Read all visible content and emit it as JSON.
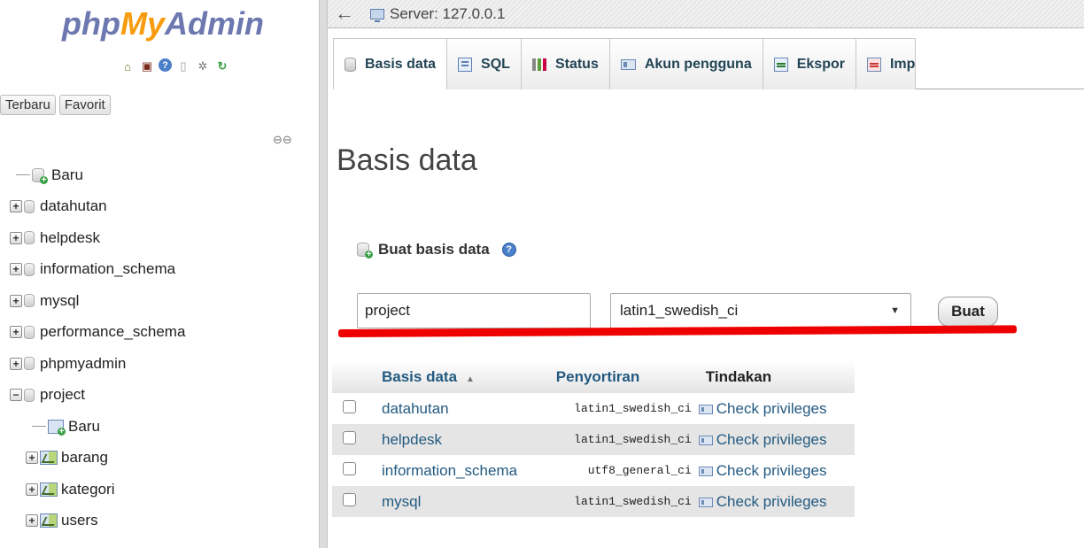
{
  "sidebar": {
    "logo": {
      "php": "php",
      "my": "My",
      "admin": "Admin"
    },
    "quick_icons": [
      "home-icon",
      "exit-icon",
      "help-icon",
      "docs-icon",
      "settings-icon",
      "reload-icon"
    ],
    "tabs": [
      "Terbaru",
      "Favorit"
    ],
    "tree": [
      {
        "type": "new",
        "label": "Baru"
      },
      {
        "type": "db",
        "label": "datahutan"
      },
      {
        "type": "db",
        "label": "helpdesk"
      },
      {
        "type": "db",
        "label": "information_schema"
      },
      {
        "type": "db",
        "label": "mysql"
      },
      {
        "type": "db",
        "label": "performance_schema"
      },
      {
        "type": "db",
        "label": "phpmyadmin"
      },
      {
        "type": "db-open",
        "label": "project"
      },
      {
        "type": "table-new",
        "label": "Baru"
      },
      {
        "type": "table",
        "label": "barang"
      },
      {
        "type": "table",
        "label": "kategori"
      },
      {
        "type": "table",
        "label": "users"
      }
    ]
  },
  "topbar": {
    "back": "←",
    "server": "Server: 127.0.0.1"
  },
  "tabs": [
    {
      "label": "Basis data",
      "icon": "database-icon"
    },
    {
      "label": "SQL",
      "icon": "sql-icon"
    },
    {
      "label": "Status",
      "icon": "status-icon"
    },
    {
      "label": "Akun pengguna",
      "icon": "users-icon"
    },
    {
      "label": "Ekspor",
      "icon": "export-icon"
    },
    {
      "label": "Imp",
      "icon": "import-icon"
    }
  ],
  "main": {
    "title": "Basis data",
    "create_label": "Buat basis data",
    "db_name_value": "project",
    "collation_value": "latin1_swedish_ci",
    "create_button": "Buat",
    "table": {
      "headers": [
        "Basis data",
        "Penyortiran",
        "Tindakan"
      ],
      "rows": [
        {
          "name": "datahutan",
          "collation": "latin1_swedish_ci",
          "action": "Check privileges"
        },
        {
          "name": "helpdesk",
          "collation": "latin1_swedish_ci",
          "action": "Check privileges"
        },
        {
          "name": "information_schema",
          "collation": "utf8_general_ci",
          "action": "Check privileges"
        },
        {
          "name": "mysql",
          "collation": "latin1_swedish_ci",
          "action": "Check privileges"
        }
      ]
    }
  },
  "colors": {
    "annotation_line": "#ee0000",
    "link": "#235a81",
    "logo_blue": "#6c78af",
    "logo_orange": "#f89c0e"
  }
}
